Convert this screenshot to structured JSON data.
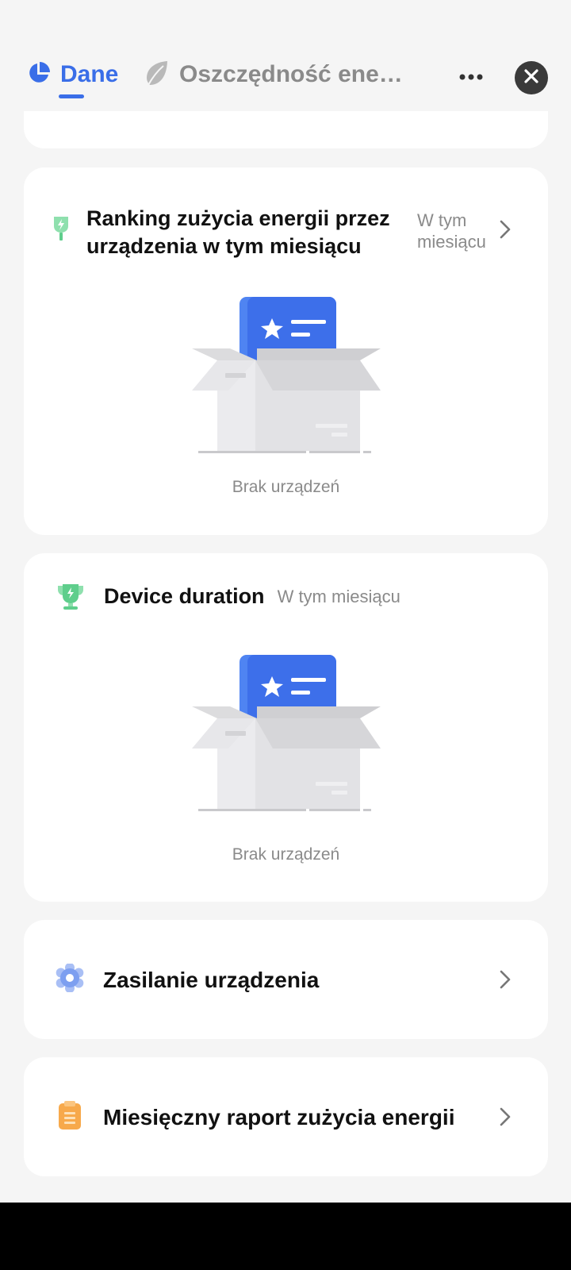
{
  "header": {
    "tabs": [
      {
        "label": "Dane",
        "active": true,
        "icon": "pie-chart-icon"
      },
      {
        "label": "Oszczędność ener…",
        "active": false,
        "icon": "leaf-icon"
      }
    ],
    "more_icon": "more-dots-icon",
    "close_icon": "close-icon"
  },
  "ranking_card": {
    "title_line1": "Ranking zużycia energii przez",
    "title_line2": "urządzenia w tym miesiącu",
    "period_line1": "W tym",
    "period_line2": "miesiącu",
    "icon": "energy-plug-icon",
    "empty_text": "Brak urządzeń"
  },
  "duration_card": {
    "title": "Device duration",
    "period": "W tym miesiącu",
    "icon": "trophy-icon",
    "empty_text": "Brak urządzeń"
  },
  "power_card": {
    "title": "Zasilanie urządzenia",
    "icon": "gear-icon"
  },
  "report_card": {
    "title": "Miesięczny raport zużycia energii",
    "icon": "clipboard-icon"
  },
  "colors": {
    "accent": "#3a6ee8",
    "background": "#f5f5f5",
    "card": "#ffffff",
    "green_icon": "#5fce8c",
    "orange_icon": "#f7a94b"
  }
}
